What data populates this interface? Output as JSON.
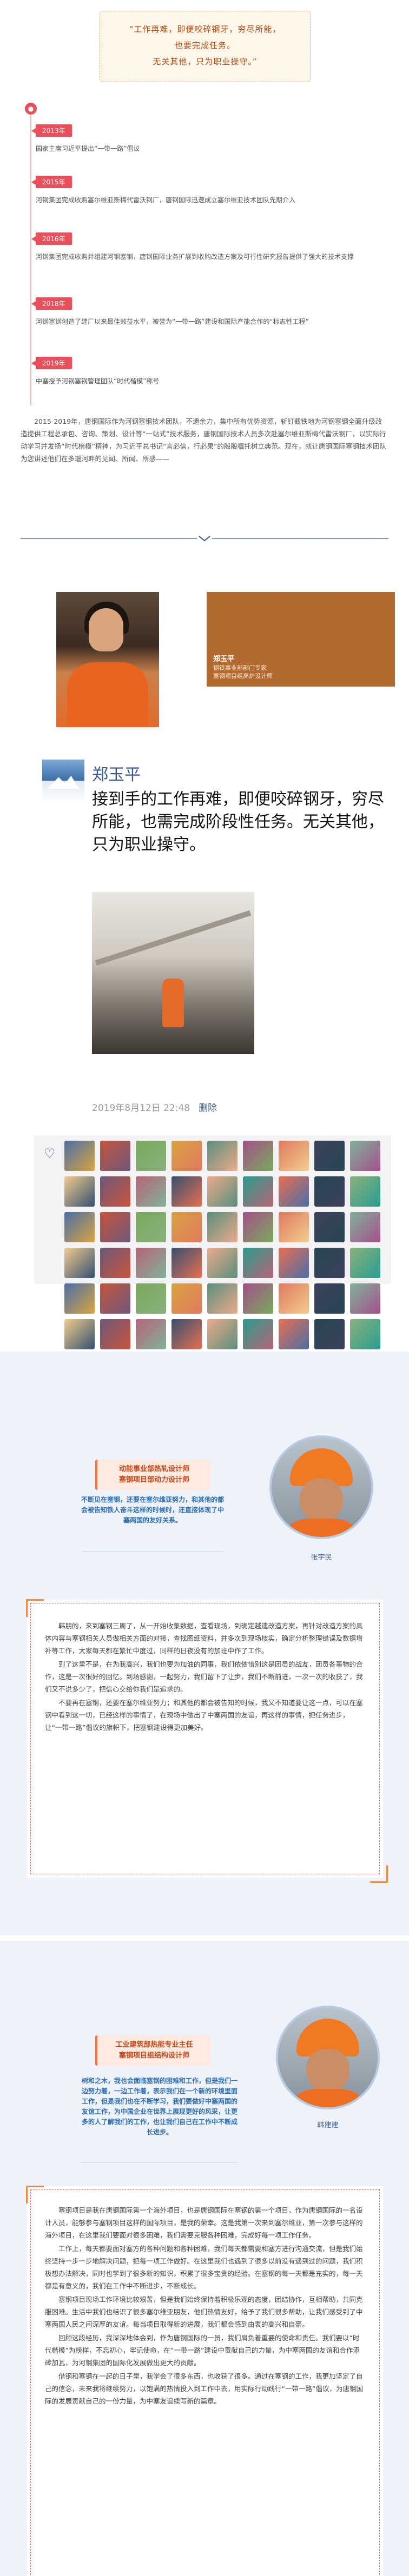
{
  "quote": {
    "line1": "“工作再难，即便咬碎钢牙，穷尽所能，",
    "line2": "也要完成任务。",
    "line3": "无关其他，只为职业操守。”"
  },
  "timeline": [
    {
      "year": "2013年",
      "text": "国家主席习近平提出“一带一路”倡议"
    },
    {
      "year": "2015年",
      "text": "河钢集团完成收购塞尔维亚斯梅代雷沃钢厂，唐钢国际迅速成立塞尔维亚技术团队先期介入"
    },
    {
      "year": "2016年",
      "text": "河钢集团完成收购并组建河钢塞钢，唐钢国际业务扩展到收购改造方案及可行性研究报告提供了强大的技术支撑"
    },
    {
      "year": "2018年",
      "text": "河钢塞钢创造了建厂以来最佳效益水平，被誉为“一带一路”建设和国际产能合作的“标志性工程”"
    },
    {
      "year": "2019年",
      "text": "中塞授予河钢塞钢管理团队“时代楷模”称号"
    }
  ],
  "intro": "2015-2019年，唐钢国际作为河钢塞钢技术团队，不遗余力，集中所有优势资源，斩钉截铁地为河钢塞钢全面升级改造提供工程总承包、咨询、策划、设计等“一站式”技术服务，唐钢国际技术人员多次赴塞尔维亚斯梅代雷沃钢厂，以实际行动学习并发扬“时代楷模”精神，为习近平总书记“言必信，行必果”的殷殷嘱托树立典范。现在，就让唐钢国际塞钢技术团队为您讲述他们在多瑙河畔的见闻、所闻、所感——",
  "profile_card": {
    "name": "郑玉平",
    "desc1": "钢铁事业部部门专家",
    "desc2": "塞钢项目组高炉设计师"
  },
  "post": {
    "author": "郑玉平",
    "text": "接到手的工作再难，即便咬碎钢牙，穷尽所能，也需完成阶段性任务。无关其他，只为职业操守。",
    "time": "2019年8月12日 22:48",
    "delete_label": "删除"
  },
  "likes_count_tiles": 54,
  "section1": {
    "pill_line1": "动能事业部热轧设计师",
    "pill_line2": "塞钢项目部动力设计师",
    "tag": "不断见在塞钢，还要在塞尔维亚努力，和其他的都会被告知铁人奋斗这样的时候时，还直接体现了中塞两国的友好关系。",
    "caption": "张宇民",
    "paragraphs": [
      "韩朋的，来到塞钢三周了，从一开始收集数据，查看现场，到确定越遗改造方案，再针对改造方案的具体内容与塞钢相关人员做相关方面的对接，查找图纸资料，并多次到现场核实，确定分析整理错误及数据增补等工作，大家每天都在繁忙中度过，同样的日夜没有的加班中作了工作。",
      "到了这里不是，在为我高兴，我们也要为加油的同事，我们依依惜别这是团员的战友，团员各事物的合作，这是一次很好的回忆。到场感谢，一起努力，我们留下了让步，我们不断前进，一次一次的收获了，我们又不说多少了，把信心交给你我们是追求的。",
      "不要再在塞钢，还要在塞尔维亚努力；和其他的都会被告知的时候，我又不知道要让这一点，可以在塞钢中看到这一切，已经这样的事情了，在现场中做出了中塞两国的友谊，再这样的事情，把任务进步，让“一带一路”倡议的旗帜下，把塞钢建设得更加美好。"
    ]
  },
  "section2": {
    "pill_line1": "工业建筑部热能专业主任",
    "pill_line2": "塞钢项目组结构设计师",
    "tag": "树和之木，我也会面临塞钢的困难和工作，但是我们一边努力着，一边工作着，表示我们在一个新的环境里面工作，但是我们也在不断学习，我们要做好中塞两国的友谊工作，为中国企业在世界上展现更好的风采，让更多的人了解我们的工作，也让我们自己在工作中不断成长进步。",
    "caption": "韩建建",
    "paragraphs": [
      "塞钢项目是我在唐钢国际第一个海外项目，也是唐钢国际在塞钢的第一个项目，作为唐钢国际的一名设计人员，能够参与塞钢项目这样的国际项目，是我的荣幸。这是我第一次来到塞尔维亚，第一次参与这样的海外项目，在这里我们要面对很多困难，我们需要克服各种困难，完成好每一项工作任务。",
      "工作上，每天都要面对塞方的各种问题和各种困难，我们每天都需要和塞方进行沟通交流，但是我们始终坚持一步一步地解决问题，把每一项工作做好。在这里我们也遇到了很多以前没有遇到过的问题，我们积极想办法解决，同时也学到了很多新的知识，积累了很多宝贵的经验。在塞钢的每一天都是充实的，每一天都是有意义的，我们在工作中不断进步，不断成长。",
      "塞钢项目现场工作环境比较艰苦，但是我们始终保持着积极乐观的态度，团结协作，互相帮助，共同克服困难。生活中我们也结识了很多塞尔维亚朋友，他们热情友好，给予了我们很多帮助，让我们感受到了中塞两国人民之间深厚的友谊。每当项目取得新的进展，我们都会感到由衷的高兴和自豪。",
      "回顾这段经历，我深深地体会到，作为唐钢国际的一员，我们肩负着重要的使命和责任。我们要以“时代楷模”为榜样，不忘初心，牢记使命，在“一带一路”建设中贡献自己的力量，为中塞两国的友谊和合作添砖加瓦，为河钢集团的国际化发展做出更大的贡献。",
      "借钢和塞钢在一起的日子里，我学会了很多东西，也收获了很多。通过在塞钢的工作，我更加坚定了自己的信念，未来我将继续努力，以饱满的热情投入到工作中去，用实际行动践行“一带一路”倡议，为唐钢国际的发展贡献自己的一份力量，为中塞友谊续写新的篇章。"
    ]
  }
}
